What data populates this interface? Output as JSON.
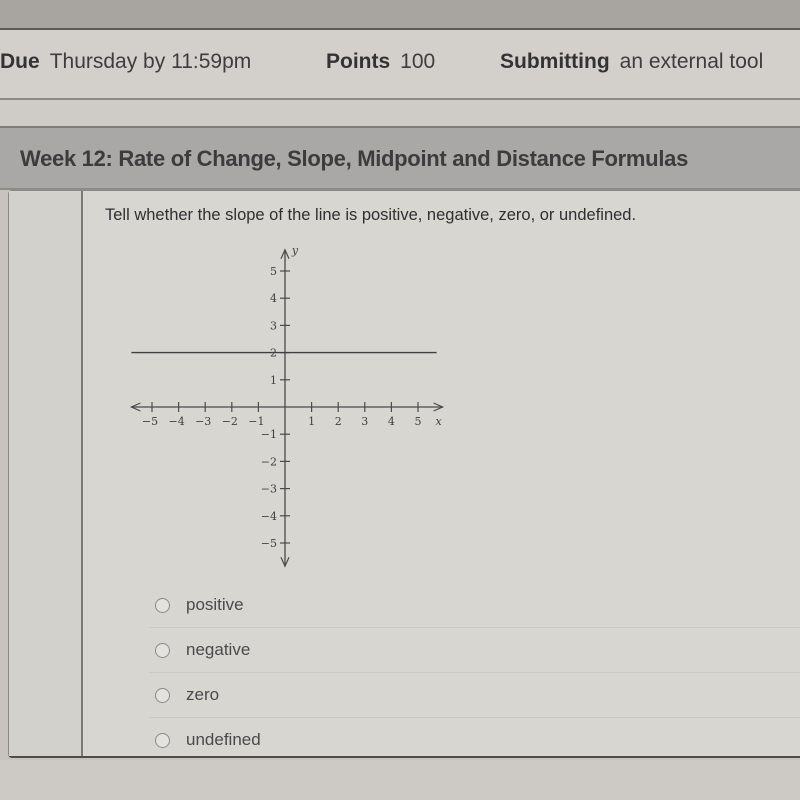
{
  "assignment_meta": {
    "due_label": "Due",
    "due_value": "Thursday by 11:59pm",
    "points_label": "Points",
    "points_value": "100",
    "submitting_label": "Submitting",
    "submitting_value": "an external tool"
  },
  "quiz": {
    "title": "Week 12: Rate of Change, Slope, Midpoint and Distance Formulas",
    "question": {
      "prompt": "Tell whether the slope of the line is positive, negative, zero, or undefined.",
      "answers": [
        {
          "label": "positive",
          "selected": false
        },
        {
          "label": "negative",
          "selected": false
        },
        {
          "label": "zero",
          "selected": false
        },
        {
          "label": "undefined",
          "selected": false
        }
      ]
    }
  },
  "chart_data": {
    "type": "line",
    "title": "",
    "xlabel": "x",
    "ylabel": "y",
    "xlim": [
      -6,
      6
    ],
    "ylim": [
      -6,
      6
    ],
    "grid": false,
    "x_ticks": [
      -5,
      -4,
      -3,
      -2,
      -1,
      1,
      2,
      3,
      4,
      5
    ],
    "y_ticks": [
      5,
      4,
      3,
      2,
      1,
      -1,
      -2,
      -3,
      -4,
      -5
    ],
    "x_tick_labels": [
      "−5",
      "−4",
      "−3",
      "−2",
      "−1",
      "1",
      "2",
      "3",
      "4",
      "5"
    ],
    "y_tick_labels": [
      "5",
      "4",
      "3",
      "2",
      "1",
      "−1",
      "−2",
      "−3",
      "−4",
      "−5"
    ],
    "series": [
      {
        "name": "horizontal line",
        "x": [
          -6,
          6
        ],
        "y": [
          2,
          2
        ]
      }
    ]
  }
}
